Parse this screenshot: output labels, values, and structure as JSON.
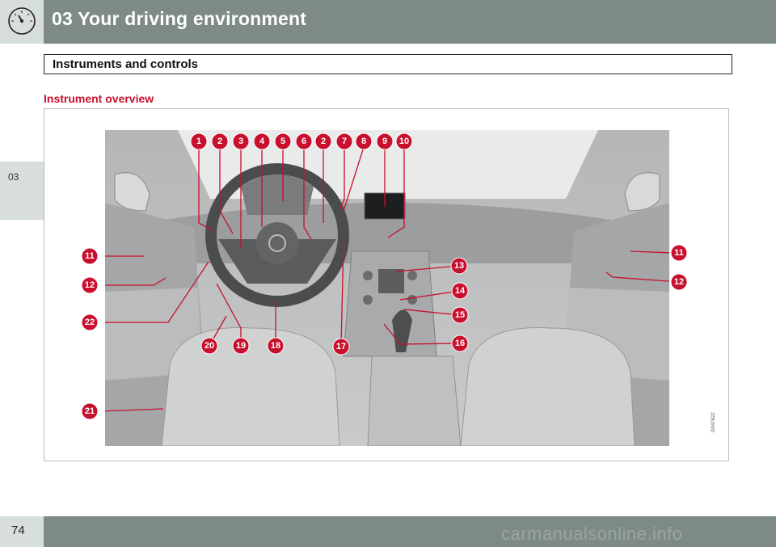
{
  "header": {
    "title": "03 Your driving environment",
    "icon": "gauge-icon"
  },
  "side_tab": {
    "label": "03"
  },
  "section": {
    "title": "Instruments and controls"
  },
  "subheading": "Instrument overview",
  "figure": {
    "code": "G047622",
    "callouts": [
      "1",
      "2",
      "3",
      "4",
      "5",
      "6",
      "2",
      "7",
      "8",
      "9",
      "10",
      "11",
      "12",
      "22",
      "21",
      "20",
      "19",
      "18",
      "17",
      "13",
      "14",
      "15",
      "16",
      "11",
      "12"
    ]
  },
  "footer": {
    "page_number": "74",
    "watermark": "carmanualsonline.info"
  },
  "colors": {
    "accent": "#c8102e",
    "header": "#7d8a88",
    "tab": "#d7dedc"
  }
}
